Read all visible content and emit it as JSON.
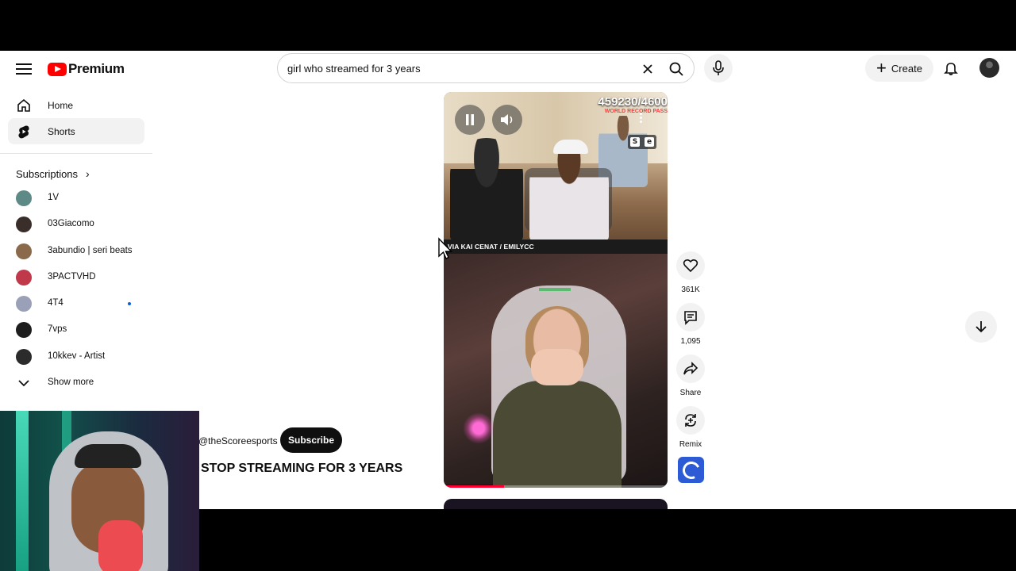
{
  "header": {
    "logo_text": "Premium",
    "search": {
      "value": "girl who streamed for 3 years",
      "placeholder": "Search"
    },
    "create_label": "Create"
  },
  "sidebar": {
    "items": [
      {
        "label": "Home",
        "icon": "home-icon"
      },
      {
        "label": "Shorts",
        "icon": "shorts-icon",
        "active": true
      }
    ],
    "subscriptions_label": "Subscriptions",
    "subscriptions": [
      {
        "name": "1V",
        "color": "#5d8a86"
      },
      {
        "name": "03Giacomo",
        "color": "#3a2e2a"
      },
      {
        "name": "3abundio | seri beats",
        "color": "#8a6a4a"
      },
      {
        "name": "3PACTVHD",
        "color": "#c0394b"
      },
      {
        "name": "4T4",
        "color": "#9aa0b8",
        "new": true
      },
      {
        "name": "7vps",
        "color": "#1e1e1e"
      },
      {
        "name": "10kkev - Artist",
        "color": "#2b2b2b"
      }
    ],
    "show_more_label": "Show more"
  },
  "short": {
    "counter": "459230/4600",
    "counter_sub": "WORLD RECORD PASS",
    "caption": "VIA KAI CENAT / EMILYCC",
    "progress": 0.27,
    "channel": "@theScoreesports",
    "subscribe_label": "Subscribe",
    "title": "STOP STREAMING FOR 3 YEARS"
  },
  "actions": {
    "like_count": "361K",
    "comment_count": "1,095",
    "share_label": "Share",
    "remix_label": "Remix"
  },
  "colors": {
    "brand": "#ff0000",
    "accent_blue": "#065fd4"
  }
}
